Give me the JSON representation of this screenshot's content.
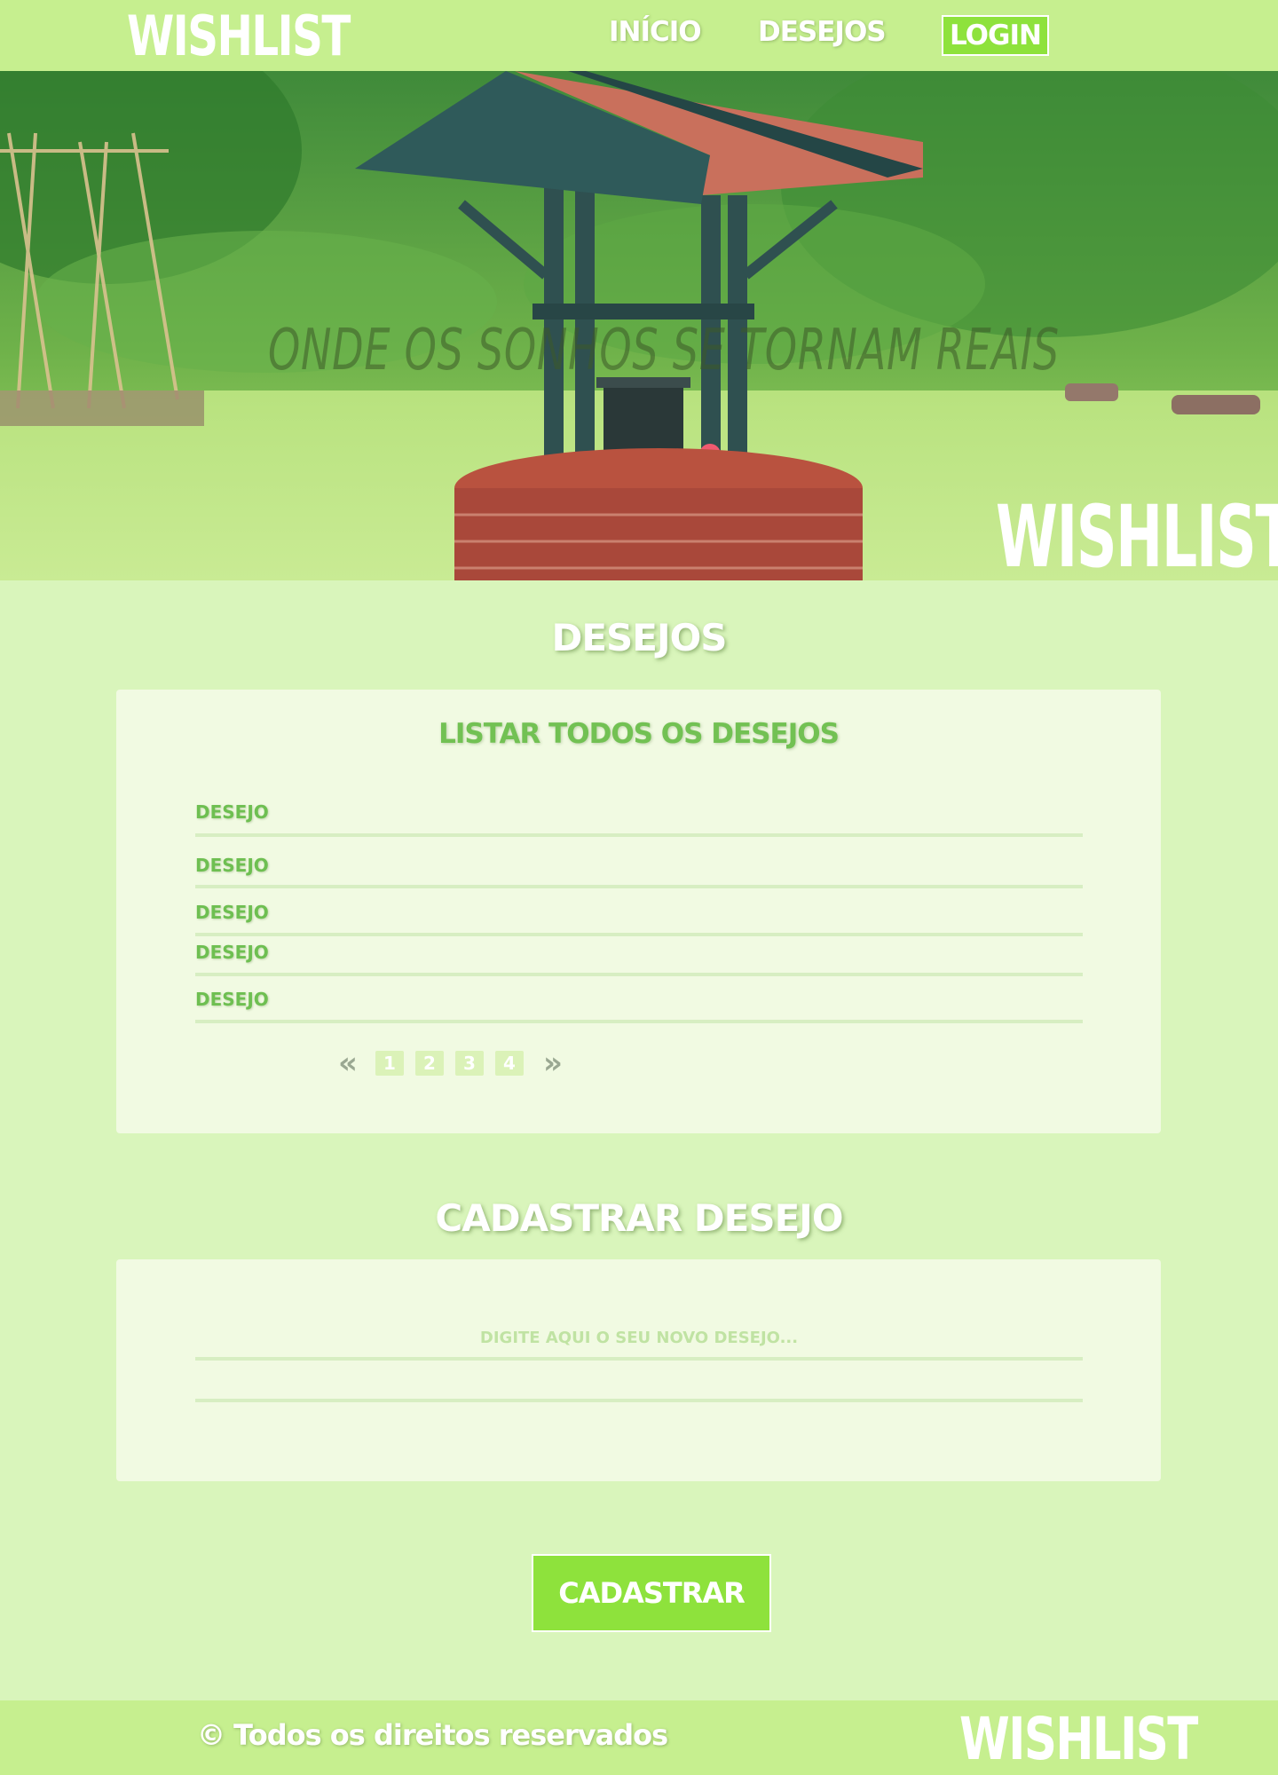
{
  "header": {
    "logo": "WISHLIST",
    "nav": {
      "inicio": "INÍCIO",
      "desejos": "DESEJOS",
      "login": "LOGIN"
    }
  },
  "hero": {
    "tagline": "ONDE OS SONHOS SE TORNAM REAIS",
    "logo": "WISHLIST"
  },
  "wishes_section": {
    "title": "DESEJOS",
    "panel_title": "LISTAR TODOS OS DESEJOS",
    "items": [
      "DESEJO",
      "DESEJO",
      "DESEJO",
      "DESEJO",
      "DESEJO"
    ],
    "pagination": {
      "prev": "«",
      "pages": [
        "1",
        "2",
        "3",
        "4"
      ],
      "next": "»"
    }
  },
  "register_section": {
    "title": "CADASTRAR DESEJO",
    "input_placeholder": "DIGITE AQUI O SEU NOVO DESEJO...",
    "input_value": "",
    "submit_label": "CADASTRAR"
  },
  "footer": {
    "copyright": "© Todos os direitos reservados",
    "logo": "WISHLIST"
  },
  "colors": {
    "header_bg": "#c6ef8f",
    "page_bg": "#d9f5bb",
    "panel_bg": "#f1fae2",
    "accent_green": "#8ee23c",
    "label_green": "#6ebf51"
  }
}
